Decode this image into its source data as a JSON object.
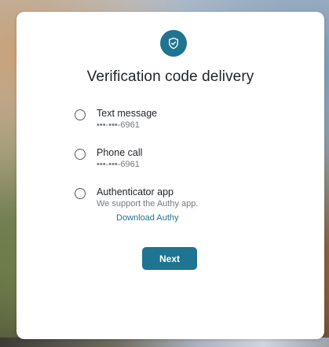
{
  "header": {
    "icon": "shield-check-icon",
    "title": "Verification code delivery"
  },
  "options": [
    {
      "label": "Text message",
      "detail": "•••-•••-6961"
    },
    {
      "label": "Phone call",
      "detail": "•••-•••-6961"
    },
    {
      "label": "Authenticator app",
      "detail": "We support the Authy app.",
      "link": "Download Authy"
    }
  ],
  "actions": {
    "next_label": "Next"
  },
  "colors": {
    "accent": "#1e7491",
    "text": "#1f2328",
    "muted": "#757a80"
  }
}
